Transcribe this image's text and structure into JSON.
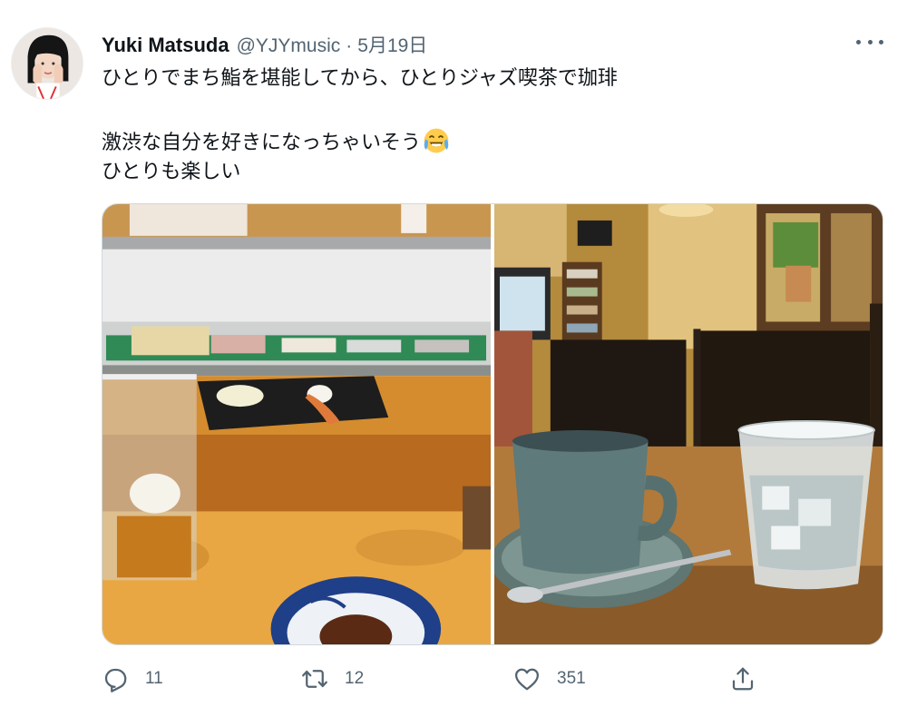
{
  "tweet": {
    "author_name": "Yuki Matsuda",
    "handle": "@YJYmusic",
    "separator": "·",
    "date": "5月19日",
    "text_lines": [
      "ひとりでまち鮨を堪能してから、ひとりジャズ喫茶で珈琲",
      "激渋な自分を好きになっちゃいそう",
      "ひとりも楽しい"
    ],
    "emoji": "face-with-tears-of-joy-icon"
  },
  "media": {
    "left_photo": "sushi-counter-photo",
    "right_photo": "jazz-cafe-coffee-photo"
  },
  "actions": {
    "reply_count": "11",
    "retweet_count": "12",
    "like_count": "351",
    "icons": [
      "reply-icon",
      "retweet-icon",
      "like-icon",
      "share-icon"
    ]
  },
  "colors": {
    "text_primary": "#0f1419",
    "text_secondary": "#536471",
    "border": "#cfd9de"
  }
}
